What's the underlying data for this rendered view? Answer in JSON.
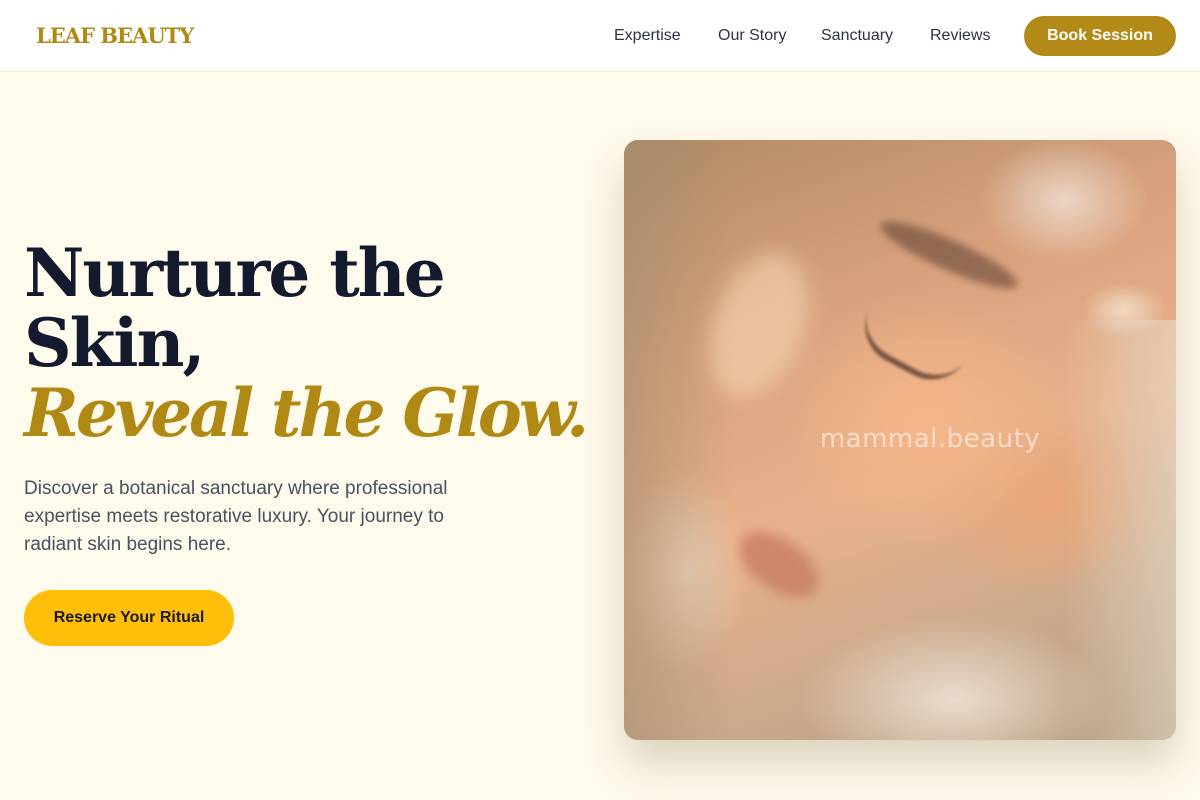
{
  "header": {
    "logo": "LEAF BEAUTY",
    "nav": [
      "Expertise",
      "Our Story",
      "Sanctuary",
      "Reviews"
    ],
    "book_label": "Book Session"
  },
  "hero": {
    "headline_line1": "Nurture the",
    "headline_line2": "Skin,",
    "headline_accent": "Reveal the Glow.",
    "description": "Discover a botanical sanctuary where professional expertise meets restorative luxury. Your journey to radiant skin begins here.",
    "cta_label": "Reserve Your Ritual",
    "image_watermark": "mammal.beauty"
  },
  "colors": {
    "gold": "#b38a17",
    "cta_yellow": "#ffbe0a",
    "cream_bg": "#fefaec",
    "navy_text": "#141a2e"
  }
}
